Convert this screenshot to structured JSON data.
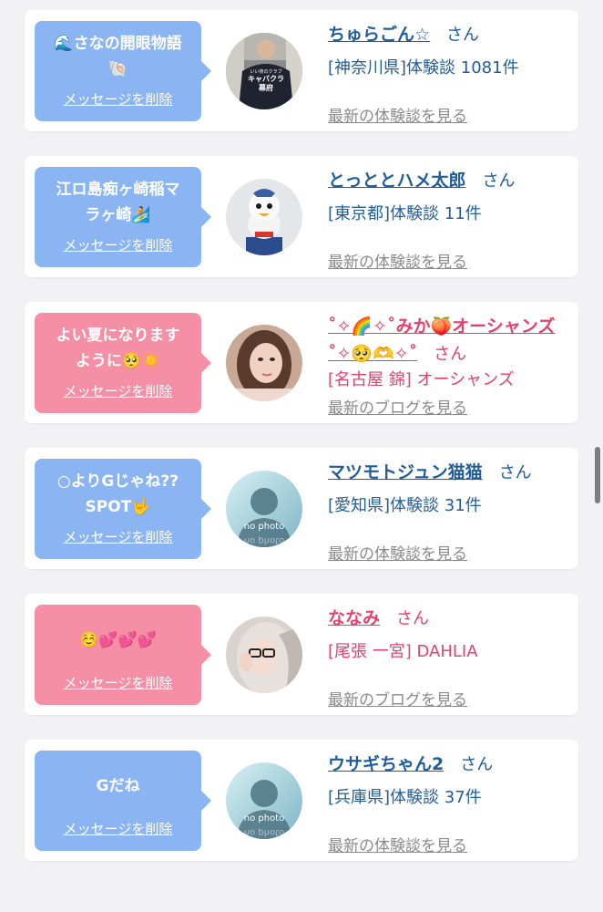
{
  "cards": [
    {
      "message": "🌊さなの開眼物語\n🐚",
      "delete_label": "メッセージを削除",
      "name": "ちゅらごん☆",
      "honorific": "さん",
      "detail": "[神奈川県]体験談 1081件",
      "more_link": "最新の体験談を見る",
      "avatar_text": "キャバクラ\n幕府",
      "avatar_small": "いい夜のクラブ"
    },
    {
      "message": "江ロ島痴ヶ崎稲マ\nラヶ崎🏄",
      "delete_label": "メッセージを削除",
      "name": "とっととハメ太郎",
      "honorific": "さん",
      "detail": "[東京都]体験談 11件",
      "more_link": "最新の体験談を見る"
    },
    {
      "message": "よい夏になります\nように🥺☀️",
      "delete_label": "メッセージを削除",
      "name": "˚✧🌈✧˚みか🍑オーシャンズ˚✧🥺🫶✧˚",
      "honorific": "さん",
      "detail": "[名古屋 錦] オーシャンズ",
      "more_link": "最新のブログを見る"
    },
    {
      "message": "○よりGじゃね??\nSPOT🤟",
      "delete_label": "メッセージを削除",
      "name": "マツモトジュン猫猫",
      "honorific": "さん",
      "detail": "[愛知県]体験談 31件",
      "more_link": "最新の体験談を見る",
      "avatar_text": "no photo"
    },
    {
      "message": "☺️💕💕💕",
      "delete_label": "メッセージを削除",
      "name": "ななみ",
      "honorific": "さん",
      "detail": "[尾張 一宮] DAHLIA",
      "more_link": "最新のブログを見る"
    },
    {
      "message": "Gだね",
      "delete_label": "メッセージを削除",
      "name": "ウサギちゃん2",
      "honorific": "さん",
      "detail": "[兵庫県]体験談 37件",
      "more_link": "最新の体験談を見る",
      "avatar_text": "no photo"
    }
  ],
  "colors": {
    "blue_bubble": "#8ab4f2",
    "pink_bubble": "#f48fa6",
    "blue_text": "#1f5d9c",
    "pink_text": "#e6416a",
    "muted_link": "#8a8a8a"
  }
}
